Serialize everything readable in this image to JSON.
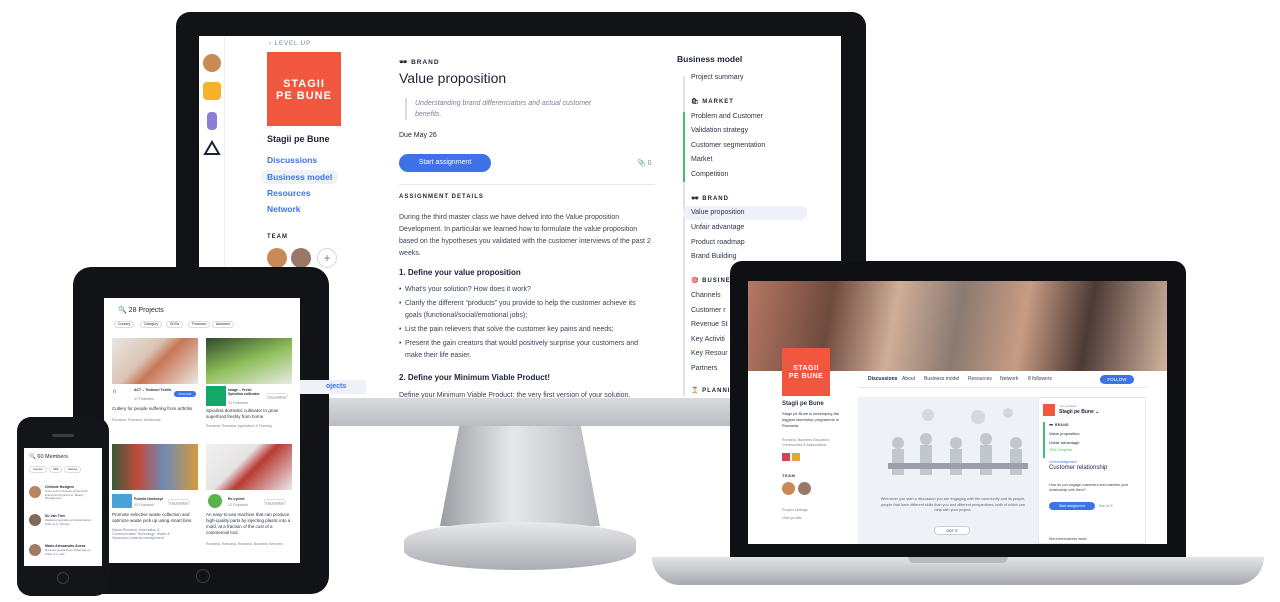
{
  "monitor": {
    "back_label": "LEVEL UP",
    "project_logo": "STAGII\nPE BUNE",
    "project_name": "Stagii pe Bune",
    "nav": [
      "Discussions",
      "Business model",
      "Resources",
      "Network"
    ],
    "team_label": "TEAM",
    "section_tag": "BRAND",
    "title": "Value proposition",
    "quote": "Understanding brand differenciators and actual customer benefits.",
    "due": "Due May 26",
    "start_button": "Start assignment",
    "attachments": "0",
    "details_heading": "ASSIGNMENT DETAILS",
    "intro": "During the third master class we have delved into the Value proposition Development. In particular we learned how to formulate the value proposition based on the hypotheses you validated with the customer interviews of the past 2 weeks.",
    "h1": "1. Define your value proposition",
    "bullets": [
      "What's your solution? How does it work?",
      "Clarify the different “products” you provide to help the customer achieve its goals (functional/social/emotional jobs);",
      "List the pain relievers that solve the customer key pains and needs;",
      "Present the gain creators that would positively surprise your customers and make their life easier."
    ],
    "h2": "2. Define your Minimum Viable Product!",
    "cut_text": "Define your Minimum Viable Product: the very first version of your solution.",
    "right_nav": {
      "title": "Business model",
      "summary": "Project summary",
      "market_label": "MARKET",
      "market_items": [
        "Problem and Customer",
        "Validation strategy",
        "Customer segmentation",
        "Market",
        "Competition"
      ],
      "brand_label": "BRAND",
      "brand_items": [
        "Value proposition",
        "Unfair advantage",
        "Product roadmap",
        "Brand Building"
      ],
      "business_label": "BUSINE",
      "business_items": [
        "Channels",
        "Customer r",
        "Revenue St",
        "Key Activiti",
        "Key Resour",
        "Partners"
      ],
      "planning_label": "PLANNI"
    },
    "behind_link": "ojects"
  },
  "tablet": {
    "search": "28 Projects",
    "filters": [
      "Country",
      "Category",
      "SDGs",
      "Financed",
      "Awarded"
    ],
    "cards": [
      {
        "name": "ACT – Textmori Textile",
        "followers": "47 Followers",
        "follow": "FOLLOW",
        "desc": "Cutlery for people suffering from arthritis",
        "tags": "Romania, Romania, Healthcare"
      },
      {
        "name": "Image – Fresh Spirulina cultivator",
        "followers": "20 Followers",
        "follow": "FOLLOWING",
        "desc": "Spirulina domestic cultivator to grow superfood freshly from home.",
        "tags": "Romania, Romania, Agriculture & Farming"
      },
      {
        "name": "Pubelle Nontoxyé",
        "followers": "33 Followers",
        "follow": "FOLLOWING",
        "desc": "Promote selective waste collection and optimize waste pick up using smart bins.",
        "tags": "Waste Romania, Information & Communication Technology, Waste & Hazardous material management"
      },
      {
        "name": "Re-cycled",
        "followers": "12 Followers",
        "follow": "FOLLOWING",
        "desc": "An easy-to-use machine that can produce high-quality parts by injecting plastic into a mold, at a fraction of the cost of a commercial tool.",
        "tags": "Romania, Romania, Romania, Business Services"
      }
    ]
  },
  "phone": {
    "search": "60 Members",
    "filters": [
      "Country",
      "Skill",
      "Interest"
    ],
    "members": [
      {
        "name": "Chrissie Hodgers",
        "desc": "Team and Co-founder at Nonprofit Enterprise Programme. Beauty Management."
      },
      {
        "name": "Su Van Tien",
        "desc": "Marketing specialist at Global Agency Entity LLC, Vietnam."
      },
      {
        "name": "Mario Alessandro Anese",
        "desc": "Business specialist at Global Agency Entity LLC, Italy"
      }
    ]
  },
  "laptop": {
    "logo": "STAGII\nPE BUNE",
    "tabs": [
      "Discussions",
      "About",
      "Business model",
      "Resources",
      "Network",
      "8 followers"
    ],
    "follow": "FOLLOW",
    "name": "Stagii pe Bune",
    "desc": "Stagii pe Bune is developing the biggest internship programme in Romania.",
    "tags": "Romania, Business Education, Communities & Associations",
    "team_label": "TEAM",
    "links": [
      "Project settings",
      "View profile"
    ],
    "panel_text": "Whenever you start a discussion you are engaging with the community and its people, people that have different skills than you and different perspectives, both of which can help with your project.",
    "got_it": "GOT IT",
    "project_label": "Your projects",
    "project_select": "Stagii pe Bune",
    "brand_label": "BRAND",
    "brand_items": [
      "Value proposition",
      "Unfair advantage"
    ],
    "complete": "33% Complete",
    "current_label": "Current assignment",
    "assignment": "Customer relationship",
    "assignment_desc": "How do you engage customers and maintain your relationship with them?",
    "start": "Start assignment",
    "due": "Due Jul 8",
    "see_model": "See entire business model"
  },
  "colors": {
    "accent": "#3d72e8",
    "brand": "#f1573e",
    "progress": "#3ac36b"
  }
}
